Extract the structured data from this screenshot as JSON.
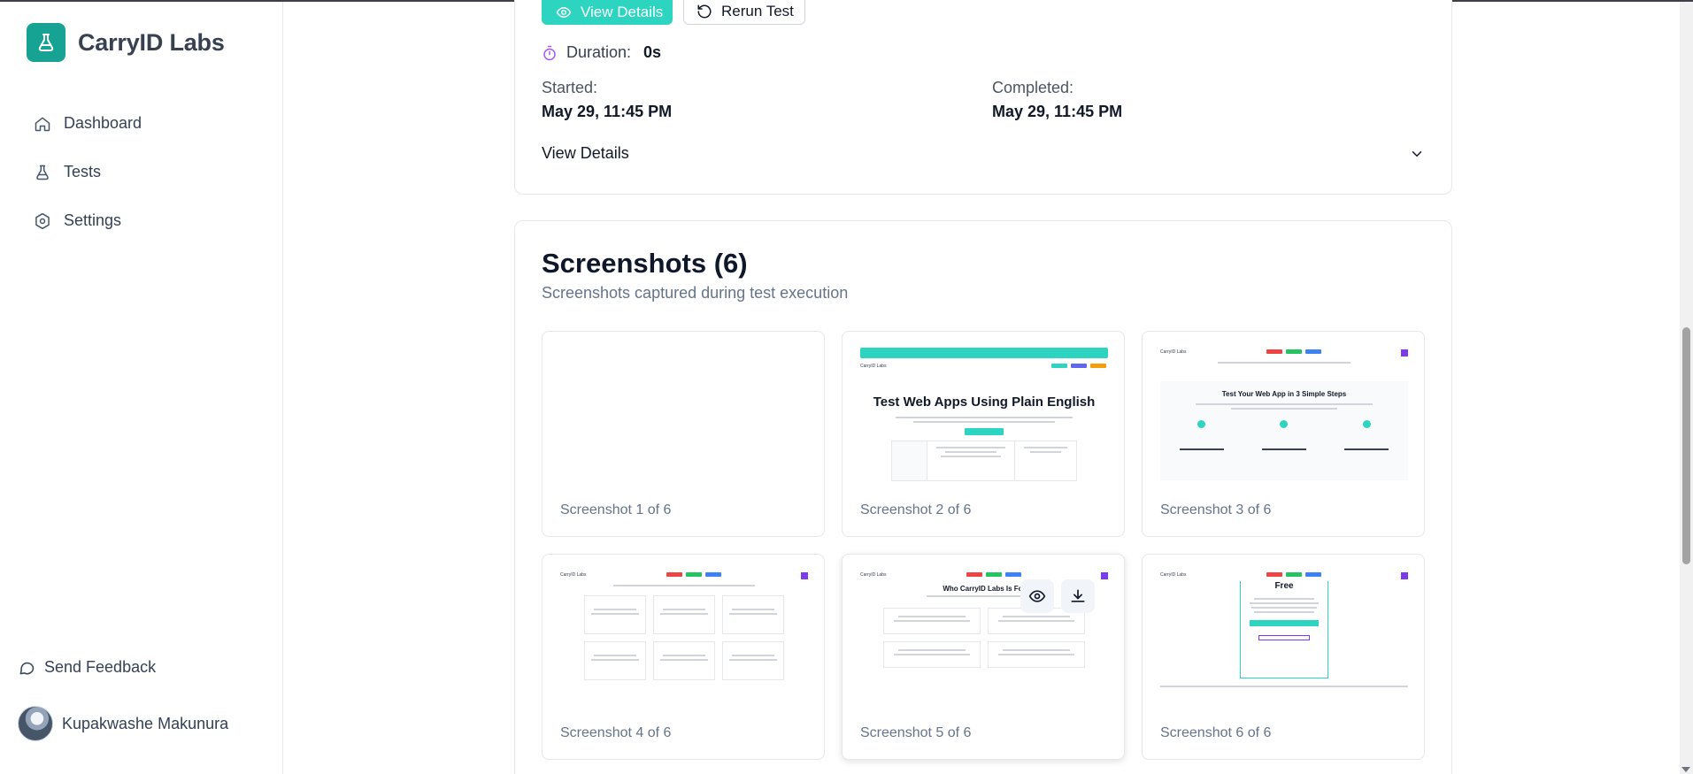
{
  "app": {
    "name": "CarryID Labs"
  },
  "sidebar": {
    "items": [
      {
        "label": "Dashboard",
        "icon": "home-icon"
      },
      {
        "label": "Tests",
        "icon": "flask-icon"
      },
      {
        "label": "Settings",
        "icon": "settings-icon"
      }
    ],
    "feedback_label": "Send Feedback",
    "user_name": "Kupakwashe Makunura"
  },
  "run": {
    "view_details_button": "View Details",
    "rerun_button": "Rerun Test",
    "duration_label": "Duration:",
    "duration_value": "0s",
    "started_label": "Started:",
    "started_value": "May 29, 11:45 PM",
    "completed_label": "Completed:",
    "completed_value": "May 29, 11:45 PM",
    "details_toggle": "View Details"
  },
  "screenshots": {
    "title": "Screenshots (6)",
    "subtitle": "Screenshots captured during test execution",
    "items": [
      {
        "caption": "Screenshot 1 of 6"
      },
      {
        "caption": "Screenshot 2 of 6",
        "preview_heading": "Test Web Apps Using Plain English"
      },
      {
        "caption": "Screenshot 3 of 6",
        "preview_heading": "Test Your Web App in 3 Simple Steps"
      },
      {
        "caption": "Screenshot 4 of 6"
      },
      {
        "caption": "Screenshot 5 of 6",
        "preview_heading": "Who CarryID Labs Is For"
      },
      {
        "caption": "Screenshot 6 of 6",
        "preview_heading": "Free"
      }
    ]
  },
  "colors": {
    "accent": "#2dd4bf",
    "brand": "#16a394",
    "duration_icon": "#a855f7"
  }
}
